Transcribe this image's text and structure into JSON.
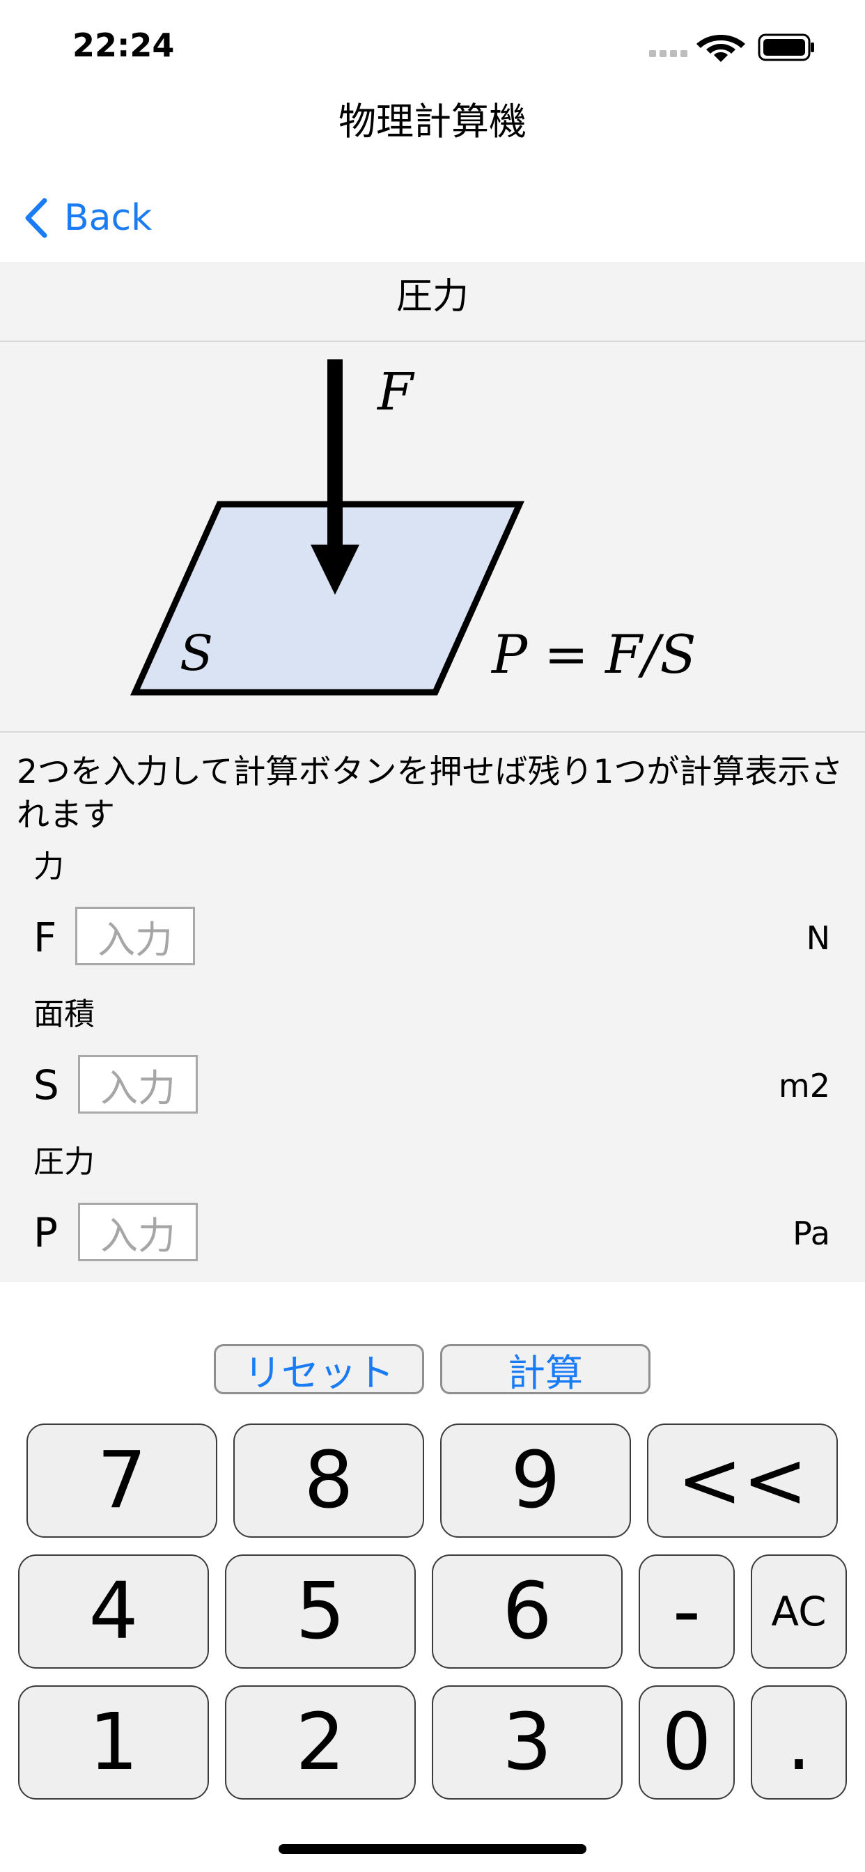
{
  "status_bar": {
    "time": "22:24"
  },
  "nav": {
    "title": "物理計算機",
    "back_label": "Back"
  },
  "section_title": "圧力",
  "figure": {
    "force_symbol": "F",
    "area_symbol": "S",
    "formula": "P = F/S",
    "plate_color": "#d9e3f4"
  },
  "instruction": "2つを入力して計算ボタンを押せば残り1つが計算表示されます",
  "fields": [
    {
      "caption": "力",
      "symbol": "F",
      "placeholder": "入力",
      "unit": "N"
    },
    {
      "caption": "面積",
      "symbol": "S",
      "placeholder": "入力",
      "unit": "m2"
    },
    {
      "caption": "圧力",
      "symbol": "P",
      "placeholder": "入力",
      "unit": "Pa"
    }
  ],
  "actions": {
    "reset_label": "リセット",
    "calc_label": "計算"
  },
  "keypad": {
    "row1": [
      "7",
      "8",
      "9",
      "<<"
    ],
    "row2": [
      "4",
      "5",
      "6",
      "-",
      "AC"
    ],
    "row3": [
      "1",
      "2",
      "3",
      "0",
      "."
    ]
  },
  "colors": {
    "accent": "#1a7cf5",
    "content_bg": "#f3f3f3"
  }
}
